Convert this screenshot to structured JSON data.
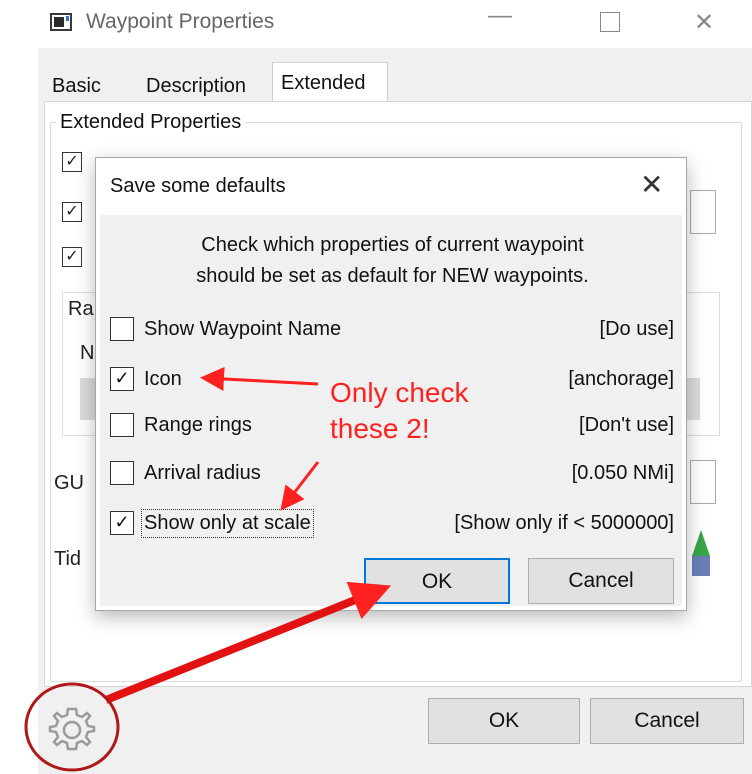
{
  "window": {
    "title": "Waypoint Properties"
  },
  "tabs": [
    {
      "label": "Basic"
    },
    {
      "label": "Description"
    },
    {
      "label": "Extended"
    }
  ],
  "extended": {
    "group_title": "Extended Properties",
    "background_labels": {
      "ra": "Ra",
      "n": "N",
      "gu": "GU",
      "tid": "Tid"
    }
  },
  "dialog": {
    "title": "Save some defaults",
    "message_line1": "Check which properties of current waypoint",
    "message_line2": "should be set as default for NEW waypoints.",
    "rows": [
      {
        "label": "Show Waypoint Name",
        "value": "[Do use]",
        "checked": false
      },
      {
        "label": "Icon",
        "value": "[anchorage]",
        "checked": true
      },
      {
        "label": "Range rings",
        "value": "[Don't use]",
        "checked": false
      },
      {
        "label": "Arrival radius",
        "value": "[0.050 NMi]",
        "checked": false
      },
      {
        "label": "Show only at scale",
        "value": "[Show only if < 5000000]",
        "checked": true
      }
    ],
    "ok_label": "OK",
    "cancel_label": "Cancel"
  },
  "buttons": {
    "ok_label": "OK",
    "cancel_label": "Cancel"
  },
  "annotation": {
    "line1": "Only check",
    "line2": "these 2!",
    "color": "#ff2020"
  },
  "icons": {
    "app": "waypoint-app-icon",
    "gear": "gear-icon",
    "close": "close-icon"
  }
}
